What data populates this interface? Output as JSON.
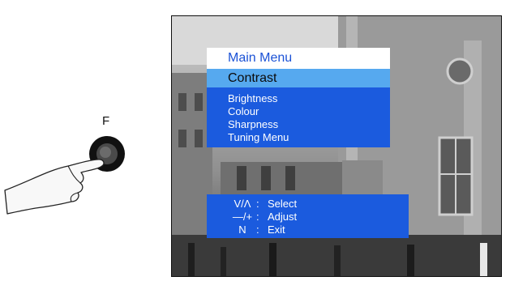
{
  "button_label": "F",
  "menu": {
    "title": "Main Menu",
    "selected": "Contrast",
    "items": [
      "Brightness",
      "Colour",
      "Sharpness",
      "Tuning Menu"
    ]
  },
  "help": [
    {
      "key": "V/Λ",
      "sep": ":",
      "action": "Select"
    },
    {
      "key": "—/+",
      "sep": ":",
      "action": "Adjust"
    },
    {
      "key": "N",
      "sep": ":",
      "action": "Exit"
    }
  ],
  "colors": {
    "menu_blue": "#1b5bde",
    "highlight_blue": "#56a9ef",
    "title_text": "#1b52d6"
  },
  "icons": [
    "hand-pointer-icon",
    "f-button-icon"
  ]
}
